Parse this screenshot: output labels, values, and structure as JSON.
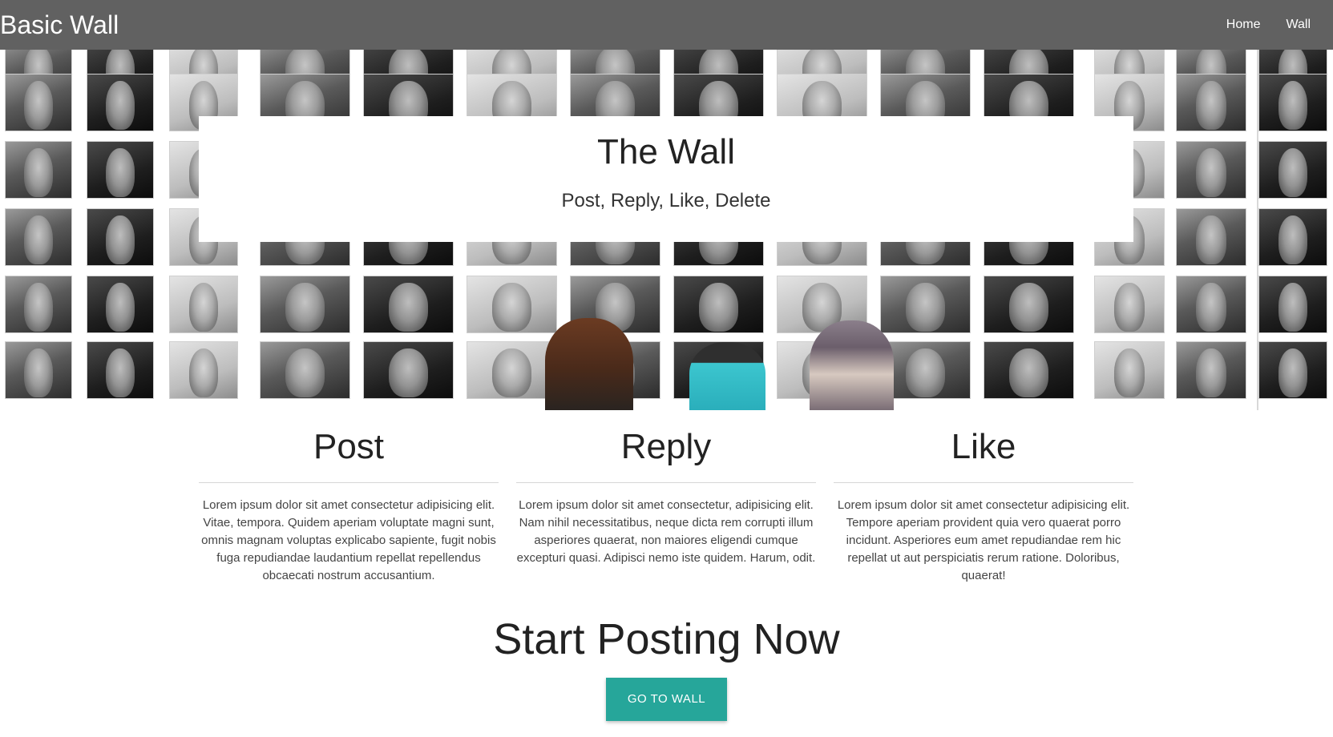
{
  "navbar": {
    "brand": "Basic Wall",
    "links": [
      "Home",
      "Wall"
    ],
    "background": "#616161"
  },
  "hero": {
    "title": "The Wall",
    "subtitle": "Post, Reply, Like, Delete"
  },
  "features": [
    {
      "title": "Post",
      "text": "Lorem ipsum dolor sit amet consectetur adipisicing elit. Vitae, tempora. Quidem aperiam voluptate magni sunt, omnis magnam voluptas explicabo sapiente, fugit nobis fuga repudiandae laudantium repellat repellendus obcaecati nostrum accusantium."
    },
    {
      "title": "Reply",
      "text": "Lorem ipsum dolor sit amet consectetur, adipisicing elit. Nam nihil necessitatibus, neque dicta rem corrupti illum asperiores quaerat, non maiores eligendi cumque excepturi quasi. Adipisci nemo iste quidem. Harum, odit."
    },
    {
      "title": "Like",
      "text": "Lorem ipsum dolor sit amet consectetur adipisicing elit. Tempore aperiam provident quia vero quaerat porro incidunt. Asperiores eum amet repudiandae rem hic repellat ut aut perspiciatis rerum ratione. Doloribus, quaerat!"
    }
  ],
  "cta": {
    "title": "Start Posting Now",
    "button": "GO TO WALL",
    "button_color": "#26a69a"
  }
}
